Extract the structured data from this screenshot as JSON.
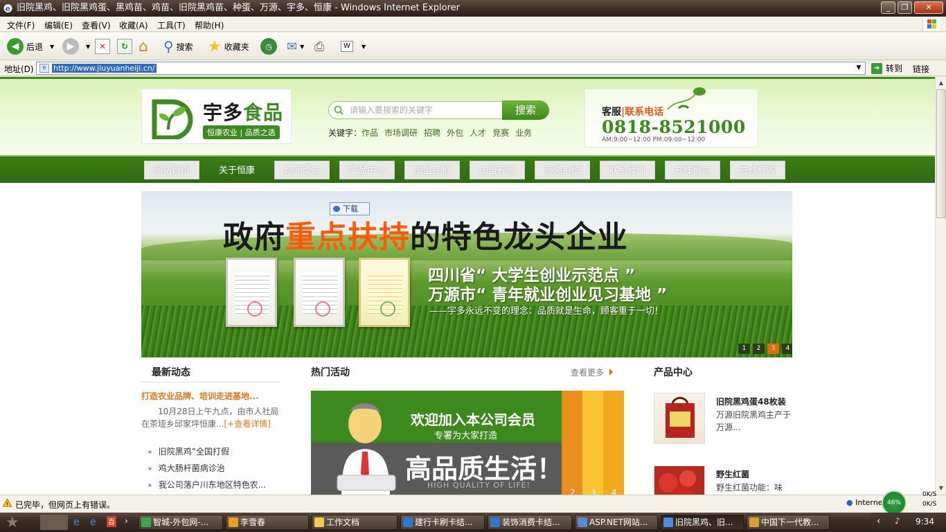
{
  "window": {
    "title": "旧院黑鸡、旧院黑鸡蛋、黑鸡苗、鸡苗、旧院黑鸡苗、种蛋、万源、宇多、恒康 - Windows Internet Explorer"
  },
  "menu": [
    "文件(F)",
    "编辑(E)",
    "查看(V)",
    "收藏(A)",
    "工具(T)",
    "帮助(H)"
  ],
  "toolbar": {
    "back_label": "后退",
    "search_label": "搜索",
    "favorites_label": "收藏夹"
  },
  "address": {
    "label": "地址(D)",
    "url": "http://www.jiuyuanheiji.cn/",
    "go_label": "转到",
    "links_label": "链接"
  },
  "site": {
    "logo_name_part1": "宇多",
    "logo_name_part2": "食品",
    "logo_slogan": "恒康农业 | 品质之选",
    "search_placeholder": "请输入要搜索的关键字",
    "search_button": "搜索",
    "keywords_label": "关键字：",
    "keywords": [
      "作品",
      "市场调研",
      "招聘",
      "外包",
      "人才",
      "竞赛",
      "业务"
    ],
    "hotline_label_a": "客服",
    "hotline_label_b": "|联系电话",
    "hotline_number": "0818-8521000",
    "hotline_hours": "AM:9:00~12:00  PM:09:00~12:00",
    "nav": [
      "网站首页",
      "关于恒康",
      "新闻动态",
      "产品中心",
      "加盟经销",
      "加盟养殖",
      "追溯系统",
      "联系我们",
      "在线留言",
      "在线订购"
    ],
    "nav_active": "关于恒康",
    "download_button": "下载",
    "banner": {
      "headline_a": "政府",
      "headline_b": "重点扶持",
      "headline_c": "的特色龙头企业",
      "line1": "四川省“ 大学生创业示范点 ”",
      "line2": "万源市“ 青年就业创业见习基地 ”",
      "line3": "——宇多永远不变的理念：品质就是生命，顾客重于一切！",
      "dots": [
        "1",
        "2",
        "3",
        "4"
      ],
      "active_dot": "3"
    },
    "news": {
      "title": "最新动态",
      "headline": "打造农业品牌、培训走进基地...",
      "summary": "10月28日上午九点，由市人社局在茶垭乡邱家坪恒康...",
      "summary_more": "[+查看详情]",
      "items": [
        "旧院黑鸡”全国打假",
        "鸡大肠杆菌病诊治",
        "我公司落户川东地区特色农..."
      ]
    },
    "hot": {
      "title": "热门活动",
      "more": "查看更多",
      "promo_t1": "欢迎加入本公司会员",
      "promo_t2": "专署为大家打造",
      "promo_t3": "高品质生活！",
      "promo_t4": "HIGH QUALITY OF LIFE!",
      "promo_nums": [
        "2",
        "3",
        "4"
      ]
    },
    "products": {
      "title": "产品中心",
      "items": [
        {
          "name": "旧院黑鸡蛋48枚装",
          "desc": "万源旧院黑鸡主产于万源..."
        },
        {
          "name": "野生红菌",
          "desc": "野生红菌功能：味"
        }
      ]
    }
  },
  "status": {
    "message": "已完毕，但网页上有错误。",
    "zone": "Internet",
    "meter": "46%",
    "net_up": "0K/S",
    "net_down": "0K/S"
  },
  "taskbar": {
    "tasks": [
      "智城-外包网-...",
      "李雪春",
      "工作文档",
      "建行卡刷卡结...",
      "装饰消费卡结...",
      "ASP.NET网站...",
      "旧院黑鸡、旧...",
      "中国下一代教..."
    ],
    "active_task": "旧院黑鸡、旧...",
    "clock": "9:34"
  }
}
